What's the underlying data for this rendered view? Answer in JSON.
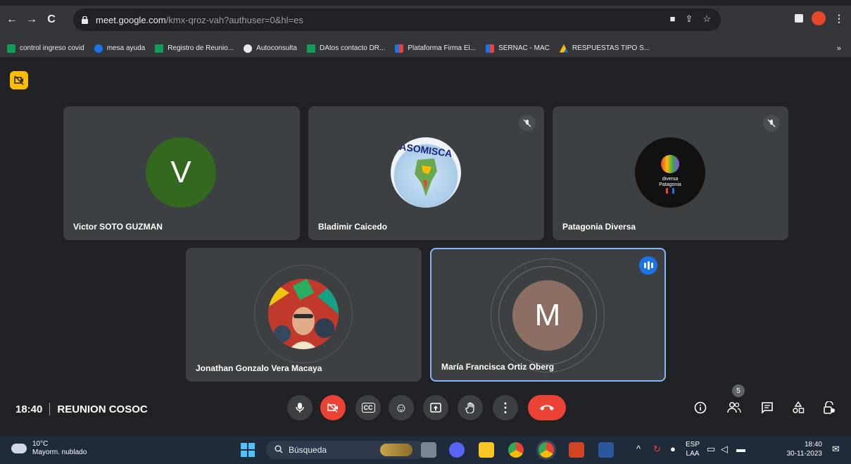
{
  "browser": {
    "url_host": "meet.google.com",
    "url_rest": "/kmx-qroz-vah?authuser=0&hl=es",
    "nav_back": "←",
    "nav_forward": "→",
    "nav_reload": "C",
    "more_menu": "⋮"
  },
  "bookmarks": [
    {
      "label": "control ingreso covid",
      "color": "#0f9d58"
    },
    {
      "label": "mesa ayuda",
      "color": "#1a73e8"
    },
    {
      "label": "Registro de Reunio...",
      "color": "#0f9d58"
    },
    {
      "label": "Autoconsulta",
      "color": "#e8eaed"
    },
    {
      "label": "DAtos contacto DR...",
      "color": "#0f9d58"
    },
    {
      "label": "Plataforma Firma El...",
      "color": "#ea4335"
    },
    {
      "label": "SERNAC - MAC",
      "color": "#ea4335"
    },
    {
      "label": "RESPUESTAS TIPO S...",
      "color": "#fbbc04"
    }
  ],
  "bookmarks_more": "»",
  "participants": [
    {
      "name": "Victor SOTO GUZMAN",
      "initial": "V",
      "avatar_color": "#33691e"
    },
    {
      "name": "Bladimir Caicedo",
      "avatar_label": "ASOMISCA"
    },
    {
      "name": "Patagonia Diversa",
      "avatar_label": "diversa Patagonia"
    },
    {
      "name": "Jonathan Gonzalo Vera Macaya"
    },
    {
      "name": "María Francisca Ortiz Oberg",
      "initial": "M",
      "avatar_color": "#8d6e63"
    }
  ],
  "meeting": {
    "time": "18:40",
    "title": "REUNION COSOC",
    "people_count": "5"
  },
  "controls": {
    "mic": "🎤",
    "camera_off": "✕",
    "captions": "CC",
    "emoji": "☺",
    "present": "▲",
    "raise_hand": "✋",
    "more": "⋮",
    "end_call": "☎",
    "info": "ⓘ",
    "people": "👥",
    "chat": "▤",
    "activities": "△",
    "host_controls": "🔒"
  },
  "taskbar": {
    "temperature": "10°C",
    "weather": "Mayorm. nublado",
    "search_placeholder": "Búsqueda",
    "language": "ESP",
    "layout": "LAA",
    "clock_time": "18:40",
    "clock_date": "30-11-2023"
  }
}
